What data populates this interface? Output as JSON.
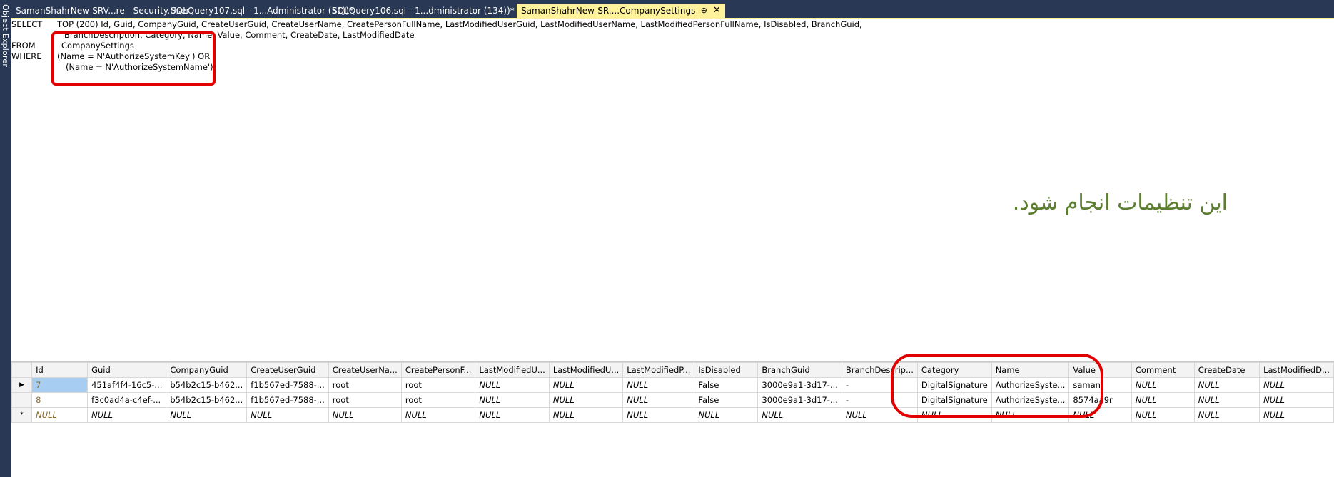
{
  "sidebar": {
    "label": "Object Explorer"
  },
  "tabs": [
    {
      "label": "SamanShahrNew-SRV...re - Security.User",
      "active": false
    },
    {
      "label": "SQLQuery107.sql - 1...Administrator (51))*",
      "active": false
    },
    {
      "label": "SQLQuery106.sql - 1...dministrator (134))*",
      "active": false
    },
    {
      "label": "SamanShahrNew-SR....CompanySettings",
      "active": true
    }
  ],
  "tab_icons": {
    "pin": "pin-icon",
    "close": "close-icon"
  },
  "sql": {
    "select_kw": "SELECT",
    "select_line1": "TOP (200) Id, Guid, CompanyGuid, CreateUserGuid, CreateUserName, CreatePersonFullName, LastModifiedUserGuid, LastModifiedUserName, LastModifiedPersonFullName, IsDisabled, BranchGuid,",
    "select_line2": "BranchDescription, Category, Name, Value, Comment, CreateDate, LastModifiedDate",
    "from_kw": "FROM",
    "from_table": "CompanySettings",
    "where_kw": "WHERE",
    "where_line1": "(Name = N'AuthorizeSystemKey') OR",
    "where_line2": "(Name = N'AuthorizeSystemName')"
  },
  "annotation_text": "این تنظیمات انجام شود.",
  "grid": {
    "columns": [
      "Id",
      "Guid",
      "CompanyGuid",
      "CreateUserGuid",
      "CreateUserNa...",
      "CreatePersonF...",
      "LastModifiedU...",
      "LastModifiedU...",
      "LastModifiedP...",
      "IsDisabled",
      "BranchGuid",
      "BranchDescrip...",
      "Category",
      "Name",
      "Value",
      "Comment",
      "CreateDate",
      "LastModifiedD..."
    ],
    "rows": [
      {
        "marker": "▶",
        "cells": [
          "7",
          "451af4f4-16c5-...",
          "b54b2c15-b462...",
          "f1b567ed-7588-...",
          "root",
          "root",
          "NULL",
          "NULL",
          "NULL",
          "False",
          "3000e9a1-3d17-...",
          "-",
          "DigitalSignature",
          "AuthorizeSyste...",
          "saman",
          "NULL",
          "NULL",
          "NULL"
        ]
      },
      {
        "marker": "",
        "cells": [
          "8",
          "f3c0ad4a-c4ef-...",
          "b54b2c15-b462...",
          "f1b567ed-7588-...",
          "root",
          "root",
          "NULL",
          "NULL",
          "NULL",
          "False",
          "3000e9a1-3d17-...",
          "-",
          "DigitalSignature",
          "AuthorizeSyste...",
          "8574aa9r",
          "NULL",
          "NULL",
          "NULL"
        ]
      },
      {
        "marker": "*",
        "cells": [
          "NULL",
          "NULL",
          "NULL",
          "NULL",
          "NULL",
          "NULL",
          "NULL",
          "NULL",
          "NULL",
          "NULL",
          "NULL",
          "NULL",
          "NULL",
          "NULL",
          "NULL",
          "NULL",
          "NULL",
          "NULL"
        ]
      }
    ]
  },
  "colors": {
    "tabbar": "#293955",
    "active_tab": "#fff29d",
    "annotation": "#e00000",
    "persian_text": "#5b7f2f"
  }
}
